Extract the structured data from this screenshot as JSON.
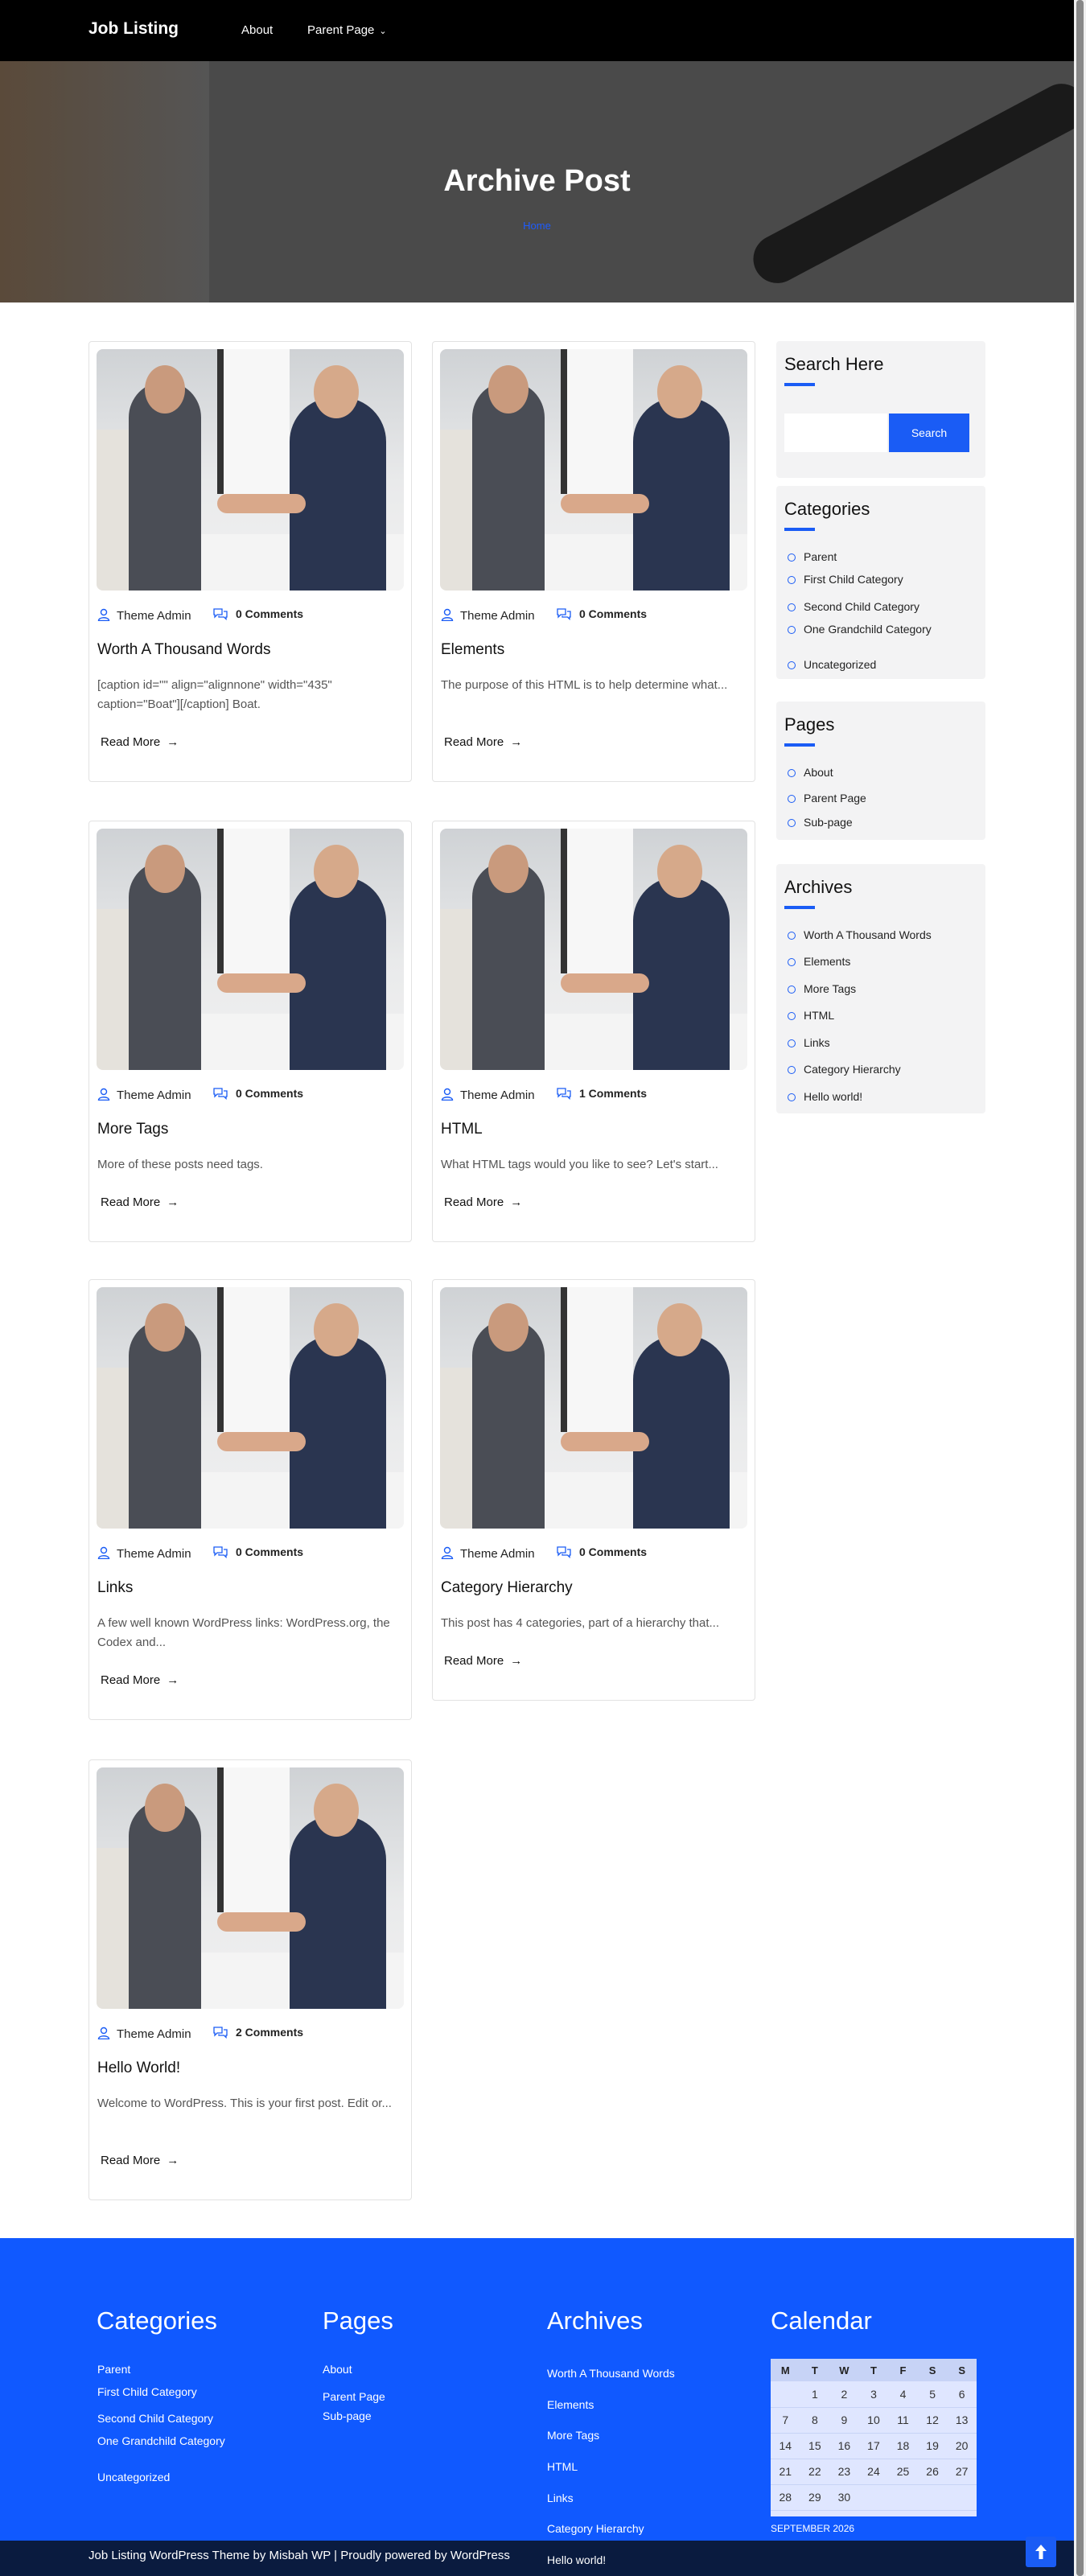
{
  "header": {
    "logo": "Job Listing",
    "nav": {
      "about": "About",
      "parent_page": "Parent Page"
    }
  },
  "hero": {
    "title": "Archive Post",
    "breadcrumb": "Home"
  },
  "posts": [
    {
      "author": "Theme Admin",
      "comments": "0 Comments",
      "title": "Worth A Thousand Words",
      "excerpt": "[caption id=\"\" align=\"alignnone\" width=\"435\" caption=\"Boat\"][/caption] Boat.",
      "read_more": "Read More"
    },
    {
      "author": "Theme Admin",
      "comments": "0 Comments",
      "title": "Elements",
      "excerpt": "The purpose of this HTML is to help determine what...",
      "read_more": "Read More"
    },
    {
      "author": "Theme Admin",
      "comments": "0 Comments",
      "title": "More Tags",
      "excerpt": "More of these posts need tags.",
      "read_more": "Read More"
    },
    {
      "author": "Theme Admin",
      "comments": "1 Comments",
      "title": "HTML",
      "excerpt": "What HTML tags would you like to see? Let's start...",
      "read_more": "Read More"
    },
    {
      "author": "Theme Admin",
      "comments": "0 Comments",
      "title": "Links",
      "excerpt": "A few well known WordPress links: WordPress.org, the Codex and...",
      "read_more": "Read More"
    },
    {
      "author": "Theme Admin",
      "comments": "0 Comments",
      "title": "Category Hierarchy",
      "excerpt": "This post has 4 categories, part of a hierarchy that...",
      "read_more": "Read More"
    },
    {
      "author": "Theme Admin",
      "comments": "2 Comments",
      "title": "Hello World!",
      "excerpt": "Welcome to WordPress. This is your first post. Edit or...",
      "read_more": "Read More"
    }
  ],
  "sidebar": {
    "search": {
      "title": "Search Here",
      "button": "Search",
      "placeholder": ""
    },
    "categories": {
      "title": "Categories",
      "items": [
        "Parent",
        "First Child Category",
        "Second Child Category",
        "One Grandchild Category",
        "Uncategorized"
      ]
    },
    "pages": {
      "title": "Pages",
      "items": [
        "About",
        "Parent Page",
        "Sub-page"
      ]
    },
    "archives": {
      "title": "Archives",
      "items": [
        "Worth A Thousand Words",
        "Elements",
        "More Tags",
        "HTML",
        "Links",
        "Category Hierarchy",
        "Hello world!"
      ]
    }
  },
  "footer": {
    "categories": {
      "title": "Categories",
      "items": [
        "Parent",
        "First Child Category",
        "Second Child Category",
        "One Grandchild Category",
        "Uncategorized"
      ]
    },
    "pages": {
      "title": "Pages",
      "items": [
        "About",
        "Parent Page",
        "Sub-page"
      ]
    },
    "archives": {
      "title": "Archives",
      "items": [
        "Worth A Thousand Words",
        "Elements",
        "More Tags",
        "HTML",
        "Links",
        "Category Hierarchy",
        "Hello world!"
      ]
    },
    "calendar": {
      "title": "Calendar",
      "days": [
        "M",
        "T",
        "W",
        "T",
        "F",
        "S",
        "S"
      ],
      "weeks": [
        [
          "",
          "1",
          "2",
          "3",
          "4",
          "5",
          "6"
        ],
        [
          "7",
          "8",
          "9",
          "10",
          "11",
          "12",
          "13"
        ],
        [
          "14",
          "15",
          "16",
          "17",
          "18",
          "19",
          "20"
        ],
        [
          "21",
          "22",
          "23",
          "24",
          "25",
          "26",
          "27"
        ],
        [
          "28",
          "29",
          "30",
          "",
          "",
          "",
          ""
        ]
      ],
      "caption": "SEPTEMBER 2026"
    },
    "copyright": "Job Listing WordPress Theme by Misbah WP | Proudly powered by WordPress"
  },
  "colors": {
    "accent": "#1a5cf5",
    "footer_bg": "#1059ff",
    "header_bg": "#000000"
  },
  "icons": {
    "author": "user-icon",
    "comments": "comments-icon",
    "read_more": "arrow-right-icon",
    "to_top": "arrow-up-icon",
    "nav_dropdown": "chevron-down-icon"
  }
}
